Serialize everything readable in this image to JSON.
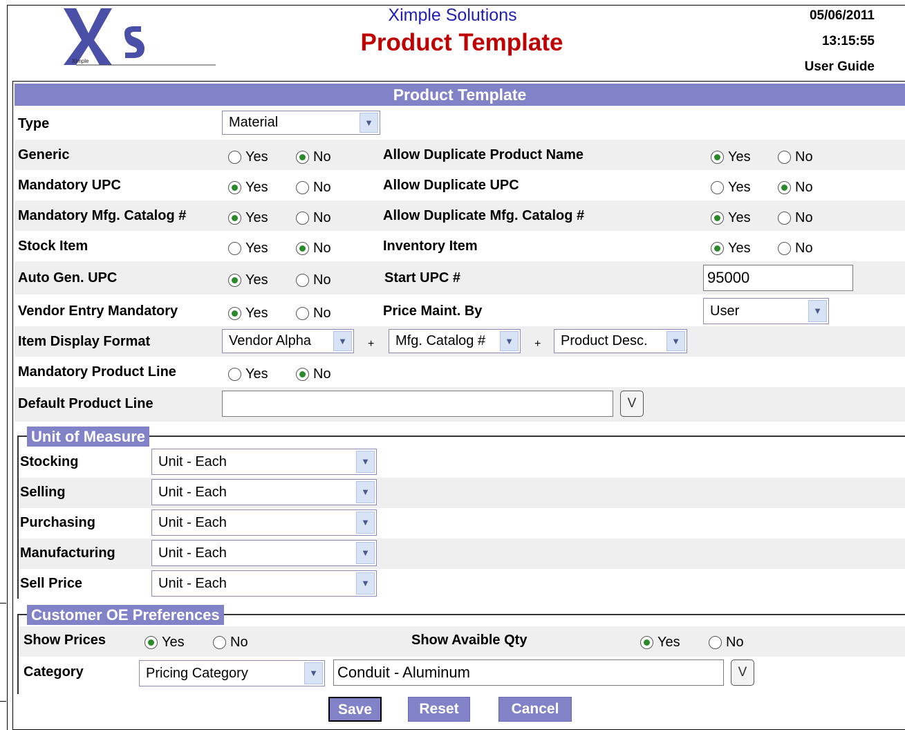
{
  "header": {
    "company": "Ximple Solutions",
    "title": "Product Template",
    "date": "05/06/2011",
    "time": "13:15:55",
    "user_guide": "User Guide",
    "logo_small_text": "Ximple"
  },
  "form": {
    "section_title": "Product Template",
    "type": {
      "label": "Type",
      "value": "Material"
    },
    "generic": {
      "label": "Generic",
      "yes": "Yes",
      "no": "No"
    },
    "allow_dup_name": {
      "label": "Allow Duplicate Product Name",
      "yes": "Yes",
      "no": "No"
    },
    "mandatory_upc": {
      "label": "Mandatory UPC",
      "yes": "Yes",
      "no": "No"
    },
    "allow_dup_upc": {
      "label": "Allow Duplicate UPC",
      "yes": "Yes",
      "no": "No"
    },
    "mandatory_mfg": {
      "label": "Mandatory Mfg. Catalog #",
      "yes": "Yes",
      "no": "No"
    },
    "allow_dup_mfg": {
      "label": "Allow Duplicate Mfg. Catalog #",
      "yes": "Yes",
      "no": "No"
    },
    "stock_item": {
      "label": "Stock Item",
      "yes": "Yes",
      "no": "No"
    },
    "inventory_item": {
      "label": "Inventory Item",
      "yes": "Yes",
      "no": "No"
    },
    "auto_gen_upc": {
      "label": "Auto Gen. UPC",
      "yes": "Yes",
      "no": "No"
    },
    "start_upc": {
      "label": "Start UPC #",
      "value": "95000"
    },
    "vendor_entry": {
      "label": "Vendor Entry Mandatory",
      "yes": "Yes",
      "no": "No"
    },
    "price_maint": {
      "label": "Price Maint. By",
      "value": "User"
    },
    "display_format": {
      "label": "Item Display Format",
      "part1": "Vendor Alpha",
      "part2": "Mfg. Catalog #",
      "part3": "Product Desc.",
      "plus": "+"
    },
    "mandatory_line": {
      "label": "Mandatory Product Line",
      "yes": "Yes",
      "no": "No"
    },
    "default_line": {
      "label": "Default Product Line",
      "value": "",
      "lookup": "V"
    }
  },
  "uom": {
    "legend": "Unit of Measure",
    "stocking": {
      "label": "Stocking",
      "value": "Unit - Each"
    },
    "selling": {
      "label": "Selling",
      "value": "Unit - Each"
    },
    "purchasing": {
      "label": "Purchasing",
      "value": "Unit - Each"
    },
    "manufacturing": {
      "label": "Manufacturing",
      "value": "Unit - Each"
    },
    "sell_price": {
      "label": "Sell Price",
      "value": "Unit - Each"
    }
  },
  "customer_oe": {
    "legend": "Customer OE Preferences",
    "show_prices": {
      "label": "Show Prices",
      "yes": "Yes",
      "no": "No"
    },
    "show_qty": {
      "label": "Show Avaible Qty",
      "yes": "Yes",
      "no": "No"
    },
    "category": {
      "label": "Category",
      "select": "Pricing Category",
      "value": "Conduit - Aluminum",
      "lookup": "V"
    }
  },
  "buttons": {
    "save": "Save",
    "reset": "Reset",
    "cancel": "Cancel"
  },
  "colors": {
    "accent": "#8282c8",
    "title_red": "#c00000",
    "company_blue": "#1f1fb8",
    "radio_dot": "#2a8a2a"
  },
  "icons": {
    "dropdown": "chevron-down-icon",
    "radio_on": "radio-selected-icon",
    "radio_off": "radio-empty-icon"
  }
}
